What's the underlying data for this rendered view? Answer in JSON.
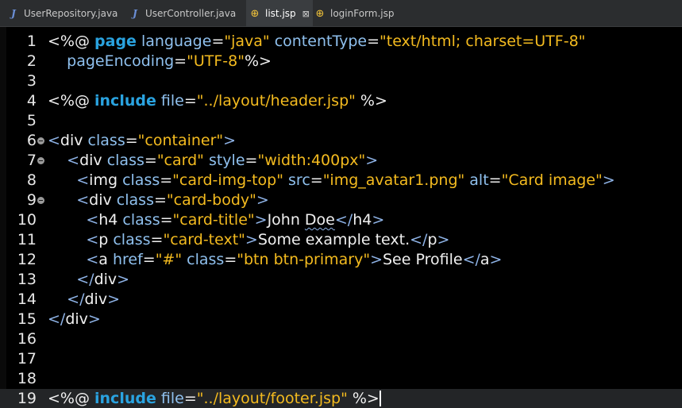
{
  "tabs": [
    {
      "label": "UserRepository.java",
      "icon": "java-file-icon",
      "active": false
    },
    {
      "label": "UserController.java",
      "icon": "java-file-icon",
      "active": false
    },
    {
      "label": "list.jsp",
      "icon": "jsp-file-icon",
      "active": true,
      "close": "⊠"
    },
    {
      "label": "loginForm.jsp",
      "icon": "jsp-file-icon",
      "active": false
    }
  ],
  "editor": {
    "lines": [
      {
        "num": "1",
        "fold": false,
        "tokens": [
          {
            "c": "t",
            "v": "<%@ "
          },
          {
            "c": "kw",
            "v": "page"
          },
          {
            "c": "at",
            "v": " language"
          },
          {
            "c": "t",
            "v": "="
          },
          {
            "c": "st",
            "v": "\"java\""
          },
          {
            "c": "at",
            "v": " contentType"
          },
          {
            "c": "t",
            "v": "="
          },
          {
            "c": "st",
            "v": "\"text/html; charset=UTF-8\""
          }
        ]
      },
      {
        "num": "2",
        "fold": false,
        "tokens": [
          {
            "c": "at",
            "v": "    pageEncoding"
          },
          {
            "c": "t",
            "v": "="
          },
          {
            "c": "st",
            "v": "\"UTF-8\""
          },
          {
            "c": "t",
            "v": "%>"
          }
        ]
      },
      {
        "num": "3",
        "fold": false,
        "tokens": []
      },
      {
        "num": "4",
        "fold": false,
        "tokens": [
          {
            "c": "t",
            "v": "<%@ "
          },
          {
            "c": "kw",
            "v": "include"
          },
          {
            "c": "at",
            "v": " file"
          },
          {
            "c": "t",
            "v": "="
          },
          {
            "c": "st",
            "v": "\"../layout/header.jsp\""
          },
          {
            "c": "t",
            "v": " %>"
          }
        ]
      },
      {
        "num": "5",
        "fold": false,
        "tokens": []
      },
      {
        "num": "6",
        "fold": true,
        "tokens": [
          {
            "c": "tg",
            "v": "<"
          },
          {
            "c": "t",
            "v": "div"
          },
          {
            "c": "at",
            "v": " class"
          },
          {
            "c": "t",
            "v": "="
          },
          {
            "c": "st",
            "v": "\"container\""
          },
          {
            "c": "tg",
            "v": ">"
          }
        ]
      },
      {
        "num": "7",
        "fold": true,
        "tokens": [
          {
            "c": "tg",
            "v": "    <"
          },
          {
            "c": "t",
            "v": "div"
          },
          {
            "c": "at",
            "v": " class"
          },
          {
            "c": "t",
            "v": "="
          },
          {
            "c": "st",
            "v": "\"card\""
          },
          {
            "c": "at",
            "v": " style"
          },
          {
            "c": "t",
            "v": "="
          },
          {
            "c": "st",
            "v": "\"width:400px\""
          },
          {
            "c": "tg",
            "v": ">"
          }
        ]
      },
      {
        "num": "8",
        "fold": false,
        "tokens": [
          {
            "c": "tg",
            "v": "      <"
          },
          {
            "c": "t",
            "v": "img"
          },
          {
            "c": "at",
            "v": " class"
          },
          {
            "c": "t",
            "v": "="
          },
          {
            "c": "st",
            "v": "\"card-img-top\""
          },
          {
            "c": "at",
            "v": " src"
          },
          {
            "c": "t",
            "v": "="
          },
          {
            "c": "st",
            "v": "\"img_avatar1.png\""
          },
          {
            "c": "at",
            "v": " alt"
          },
          {
            "c": "t",
            "v": "="
          },
          {
            "c": "st",
            "v": "\"Card image\""
          },
          {
            "c": "tg",
            "v": ">"
          }
        ]
      },
      {
        "num": "9",
        "fold": true,
        "tokens": [
          {
            "c": "tg",
            "v": "      <"
          },
          {
            "c": "t",
            "v": "div"
          },
          {
            "c": "at",
            "v": " class"
          },
          {
            "c": "t",
            "v": "="
          },
          {
            "c": "st",
            "v": "\"card-body\""
          },
          {
            "c": "tg",
            "v": ">"
          }
        ]
      },
      {
        "num": "10",
        "fold": false,
        "tokens": [
          {
            "c": "tg",
            "v": "        <"
          },
          {
            "c": "t",
            "v": "h4"
          },
          {
            "c": "at",
            "v": " class"
          },
          {
            "c": "t",
            "v": "="
          },
          {
            "c": "st",
            "v": "\"card-title\""
          },
          {
            "c": "tg",
            "v": ">"
          },
          {
            "c": "t",
            "v": "John "
          },
          {
            "c": "t wavy",
            "v": "Doe"
          },
          {
            "c": "tg",
            "v": "</"
          },
          {
            "c": "t",
            "v": "h4"
          },
          {
            "c": "tg",
            "v": ">"
          }
        ]
      },
      {
        "num": "11",
        "fold": false,
        "tokens": [
          {
            "c": "tg",
            "v": "        <"
          },
          {
            "c": "t",
            "v": "p"
          },
          {
            "c": "at",
            "v": " class"
          },
          {
            "c": "t",
            "v": "="
          },
          {
            "c": "st",
            "v": "\"card-text\""
          },
          {
            "c": "tg",
            "v": ">"
          },
          {
            "c": "t",
            "v": "Some example text."
          },
          {
            "c": "tg",
            "v": "</"
          },
          {
            "c": "t",
            "v": "p"
          },
          {
            "c": "tg",
            "v": ">"
          }
        ]
      },
      {
        "num": "12",
        "fold": false,
        "tokens": [
          {
            "c": "tg",
            "v": "        <"
          },
          {
            "c": "t",
            "v": "a"
          },
          {
            "c": "at",
            "v": " href"
          },
          {
            "c": "t",
            "v": "="
          },
          {
            "c": "st",
            "v": "\"#\""
          },
          {
            "c": "at",
            "v": " class"
          },
          {
            "c": "t",
            "v": "="
          },
          {
            "c": "st",
            "v": "\"btn btn-primary\""
          },
          {
            "c": "tg",
            "v": ">"
          },
          {
            "c": "t",
            "v": "See Profile"
          },
          {
            "c": "tg",
            "v": "</"
          },
          {
            "c": "t",
            "v": "a"
          },
          {
            "c": "tg",
            "v": ">"
          }
        ]
      },
      {
        "num": "13",
        "fold": false,
        "tokens": [
          {
            "c": "tg",
            "v": "      </"
          },
          {
            "c": "t",
            "v": "div"
          },
          {
            "c": "tg",
            "v": ">"
          }
        ]
      },
      {
        "num": "14",
        "fold": false,
        "tokens": [
          {
            "c": "tg",
            "v": "    </"
          },
          {
            "c": "t",
            "v": "div"
          },
          {
            "c": "tg",
            "v": ">"
          }
        ]
      },
      {
        "num": "15",
        "fold": false,
        "tokens": [
          {
            "c": "tg",
            "v": "</"
          },
          {
            "c": "t",
            "v": "div"
          },
          {
            "c": "tg",
            "v": ">"
          }
        ]
      },
      {
        "num": "16",
        "fold": false,
        "tokens": []
      },
      {
        "num": "17",
        "fold": false,
        "tokens": []
      },
      {
        "num": "18",
        "fold": false,
        "tokens": []
      },
      {
        "num": "19",
        "fold": false,
        "current": true,
        "caret": true,
        "tokens": [
          {
            "c": "t",
            "v": "<%@ "
          },
          {
            "c": "kw",
            "v": "include"
          },
          {
            "c": "at",
            "v": " file"
          },
          {
            "c": "t",
            "v": "="
          },
          {
            "c": "st",
            "v": "\"../layout/footer.jsp\""
          },
          {
            "c": "t",
            "v": " %>"
          }
        ]
      }
    ]
  },
  "colors": {
    "background": "#000000",
    "tabbar": "#2b2d2f",
    "active_tab": "#3a3d40",
    "string": "#f4bb1f",
    "keyword": "#2aa3e0",
    "attribute": "#8fc0ee",
    "tag": "#8fb4e8",
    "text": "#f0f0f0"
  }
}
